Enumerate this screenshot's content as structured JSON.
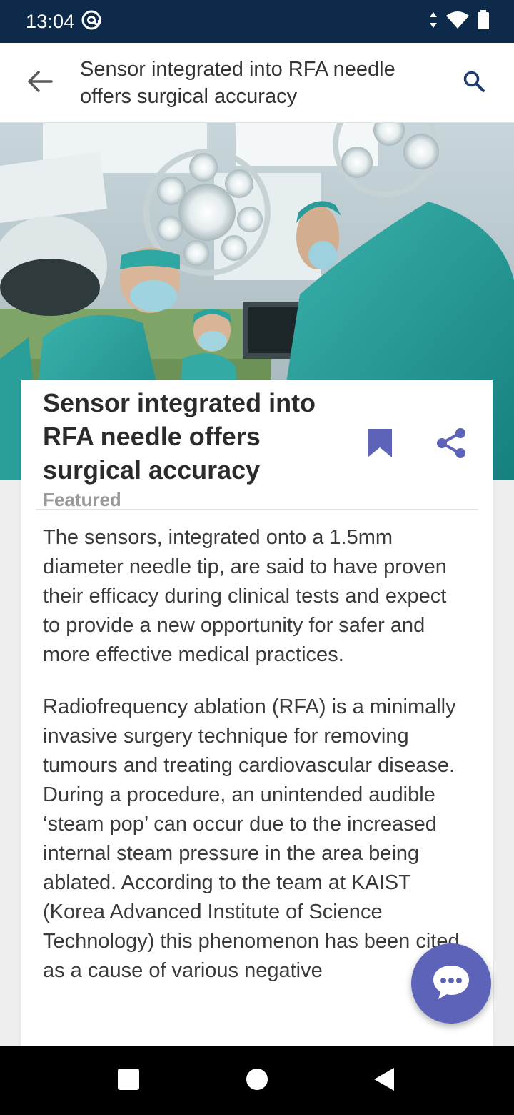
{
  "status_bar": {
    "time": "13:04",
    "icons": [
      "at-sign-icon",
      "data-arrows-icon",
      "wifi-icon",
      "battery-icon"
    ]
  },
  "app_bar": {
    "title": "Sensor integrated into RFA needle offers surgical accuracy",
    "back_icon": "arrow-left-icon",
    "search_icon": "search-icon"
  },
  "hero": {
    "icon": "surgeons-photo"
  },
  "article": {
    "title": "Sensor integrated into RFA needle offers surgical accuracy",
    "tag": "Featured",
    "paragraphs": [
      "The sensors, integrated onto a 1.5mm diameter needle tip, are said to have proven their efficacy during clinical tests and expect to provide a new opportunity for safer and more effective medical practices.",
      "Radiofrequency ablation (RFA) is a minimally invasive surgery technique for removing tumours and treating cardiovascular disease. During a procedure, an unintended audible ‘steam pop’ can occur due to the increased internal steam pressure in the area being ablated. According to the team at KAIST (Korea Advanced Institute of Science Technology) this phenomenon has been cited as a cause of various negative"
    ]
  },
  "actions": {
    "bookmark_icon": "bookmark-icon",
    "share_icon": "share-icon",
    "chat_icon": "chat-bubble-icon"
  },
  "nav": {
    "icons": [
      "square-recents-icon",
      "circle-home-icon",
      "triangle-back-icon"
    ]
  },
  "colors": {
    "status_bar": "#0d2a4b",
    "accent": "#5c63b8",
    "search": "#1e3a6e"
  }
}
